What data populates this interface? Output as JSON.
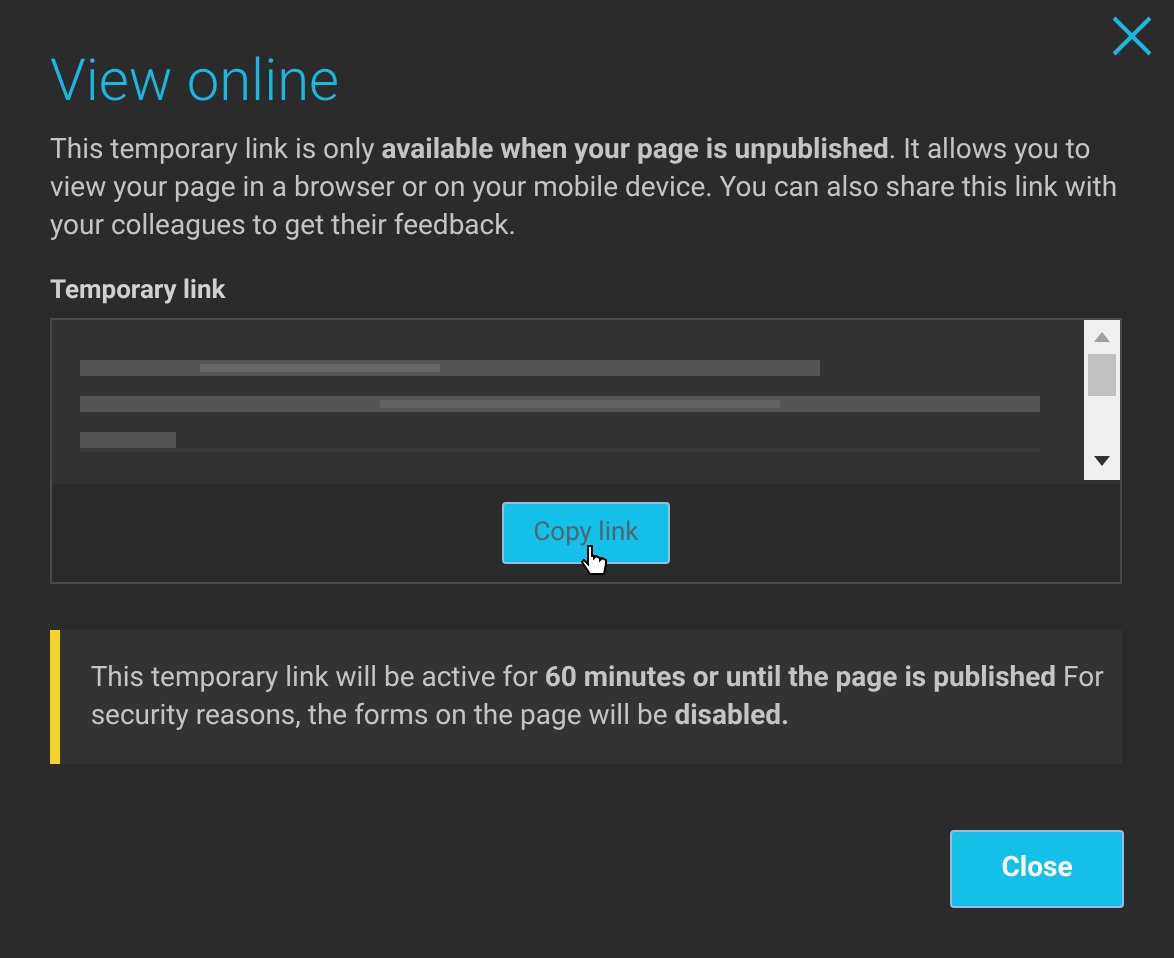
{
  "dialog": {
    "title": "View online",
    "intro": "This temporary link is only **available when your page is unpublished**. It allows you to view your page in a browser or on your mobile device. You can also share this link with your colleagues to get their feedback.",
    "link_label": "Temporary link",
    "copy_button": "Copy link",
    "notice": "This temporary link will be active for **60 minutes or until the page is published** For security reasons, the forms on the page will be **disabled.**",
    "close_button": "Close"
  }
}
